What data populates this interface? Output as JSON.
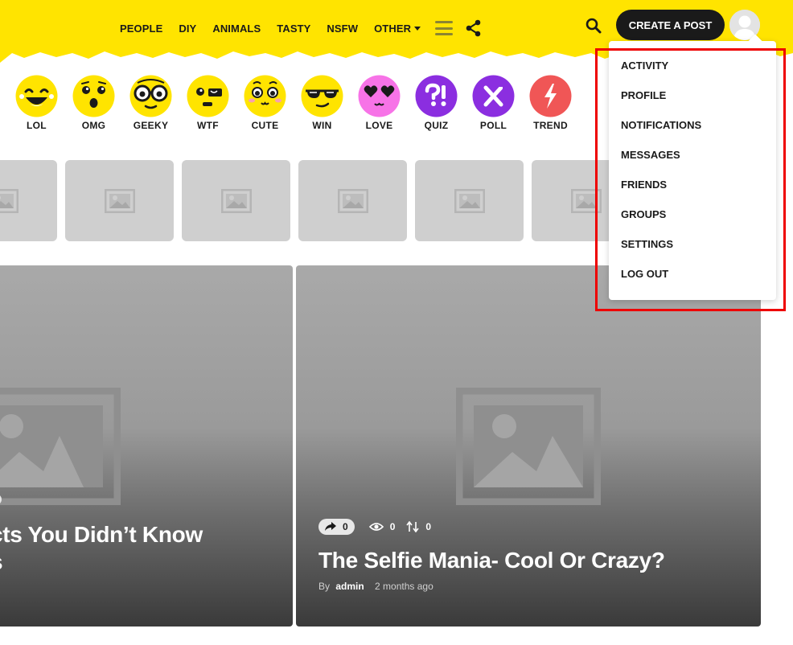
{
  "colors": {
    "header_yellow": "#ffe400",
    "dark": "#1a1a1a",
    "highlight": "#ee0000",
    "menu_icon": "#8b8531"
  },
  "nav": {
    "items": [
      "PEOPLE",
      "DIY",
      "ANIMALS",
      "TASTY",
      "NSFW"
    ],
    "other_label": "OTHER",
    "icons": [
      "menu-icon",
      "share-icon",
      "search-icon"
    ]
  },
  "header": {
    "create_post_label": "CREATE A POST",
    "avatar_icon": "user-avatar"
  },
  "reactions": [
    {
      "label": "LOL",
      "icon": "lol-face",
      "color": "#ffe400"
    },
    {
      "label": "OMG",
      "icon": "omg-face",
      "color": "#ffe400"
    },
    {
      "label": "GEEKY",
      "icon": "geeky-face",
      "color": "#ffe400"
    },
    {
      "label": "WTF",
      "icon": "wtf-face",
      "color": "#ffe400"
    },
    {
      "label": "CUTE",
      "icon": "cute-face",
      "color": "#ffe400"
    },
    {
      "label": "WIN",
      "icon": "win-face",
      "color": "#ffe400"
    },
    {
      "label": "LOVE",
      "icon": "love-face",
      "color": "#f773e7"
    },
    {
      "label": "QUIZ",
      "icon": "quiz-badge",
      "color": "#8b2ee0"
    },
    {
      "label": "POLL",
      "icon": "poll-badge",
      "color": "#8b2ee0"
    },
    {
      "label": "TREND",
      "icon": "trend-badge",
      "color": "#f05656"
    }
  ],
  "user_menu": {
    "items": [
      "ACTIVITY",
      "PROFILE",
      "NOTIFICATIONS",
      "MESSAGES",
      "FRIENDS",
      "GROUPS",
      "SETTINGS",
      "LOG OUT"
    ]
  },
  "cards": [
    {
      "title_line1": "cts You Didn’t Know",
      "title_line2": "s"
    },
    {
      "shares": "0",
      "views": "0",
      "votes": "0",
      "title": "The Selfie Mania- Cool Or Crazy?",
      "by_label": "By",
      "author": "admin",
      "time": "2 months ago"
    }
  ]
}
